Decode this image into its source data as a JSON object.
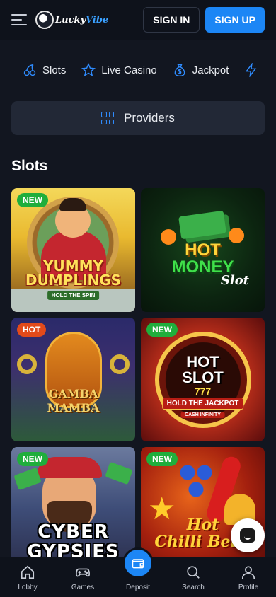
{
  "header": {
    "logo_text_1": "Lucky",
    "logo_text_2": "Vibe",
    "signin_label": "SIGN IN",
    "signup_label": "SIGN UP"
  },
  "categories": [
    {
      "label": "Slots",
      "icon": "cherries-icon"
    },
    {
      "label": "Live Casino",
      "icon": "star-icon"
    },
    {
      "label": "Jackpot",
      "icon": "money-bag-icon"
    },
    {
      "label": "",
      "icon": "lightning-icon"
    }
  ],
  "providers": {
    "label": "Providers",
    "icon": "grid-icon"
  },
  "section": {
    "title": "Slots"
  },
  "games": [
    {
      "badge": "NEW",
      "badge_type": "new",
      "title_1": "YUMMY",
      "title_2": "DUMPLINGS",
      "subtitle": "HOLD THE SPIN"
    },
    {
      "badge": "",
      "badge_type": "",
      "title_1": "HOT",
      "title_2": "MONEY",
      "subtitle": "Slot"
    },
    {
      "badge": "HOT",
      "badge_type": "hot",
      "title_1": "GAMBA",
      "title_2": "MAMBA",
      "subtitle": ""
    },
    {
      "badge": "NEW",
      "badge_type": "new",
      "title_1": "HOT",
      "title_2": "SLOT",
      "sevens": "777",
      "subtitle": "HOLD THE JACKPOT",
      "subtitle_2": "CASH INFINITY"
    },
    {
      "badge": "NEW",
      "badge_type": "new",
      "title_1": "CYBER",
      "title_2": "GYPSIES",
      "subtitle": ""
    },
    {
      "badge": "NEW",
      "badge_type": "new",
      "title_1": "Hot",
      "title_2": "Chilli Bells",
      "subtitle": ""
    }
  ],
  "bottom_nav": [
    {
      "label": "Lobby",
      "icon": "home-icon"
    },
    {
      "label": "Games",
      "icon": "gamepad-icon"
    },
    {
      "label": "Deposit",
      "icon": "wallet-icon"
    },
    {
      "label": "Search",
      "icon": "search-icon"
    },
    {
      "label": "Profile",
      "icon": "user-icon"
    }
  ],
  "colors": {
    "background": "#121620",
    "header": "#0e121b",
    "accent": "#1c86f5",
    "badge_new": "#1fae3c",
    "badge_hot": "#e24a1a"
  }
}
